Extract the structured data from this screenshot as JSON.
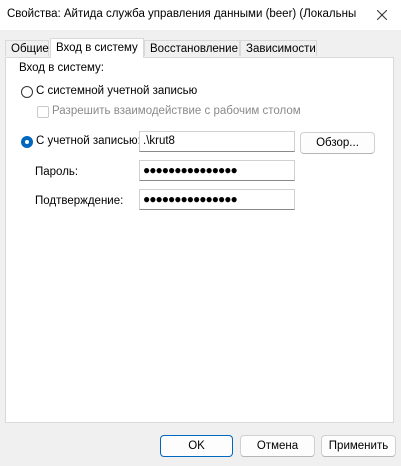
{
  "window": {
    "title": "Свойства: Айтида служба управления данными (beer) (Локальны"
  },
  "tabs": [
    {
      "label": "Общие"
    },
    {
      "label": "Вход в систему"
    },
    {
      "label": "Восстановление"
    },
    {
      "label": "Зависимости"
    }
  ],
  "logon": {
    "group_label": "Вход в систему:",
    "system_account_label": "С системной учетной записью",
    "interact_desktop_label": "Разрешить взаимодействие с рабочим столом",
    "this_account_label": "С учетной записью:",
    "account_value": ".\\krut8",
    "browse_label": "Обзор...",
    "password_label": "Пароль:",
    "password_value": "●●●●●●●●●●●●●●●",
    "confirm_label": "Подтверждение:",
    "confirm_value": "●●●●●●●●●●●●●●●",
    "selected_option": "this_account"
  },
  "footer": {
    "ok_label": "OK",
    "cancel_label": "Отмена",
    "apply_label": "Применить"
  },
  "colors": {
    "accent": "#0067c0"
  }
}
